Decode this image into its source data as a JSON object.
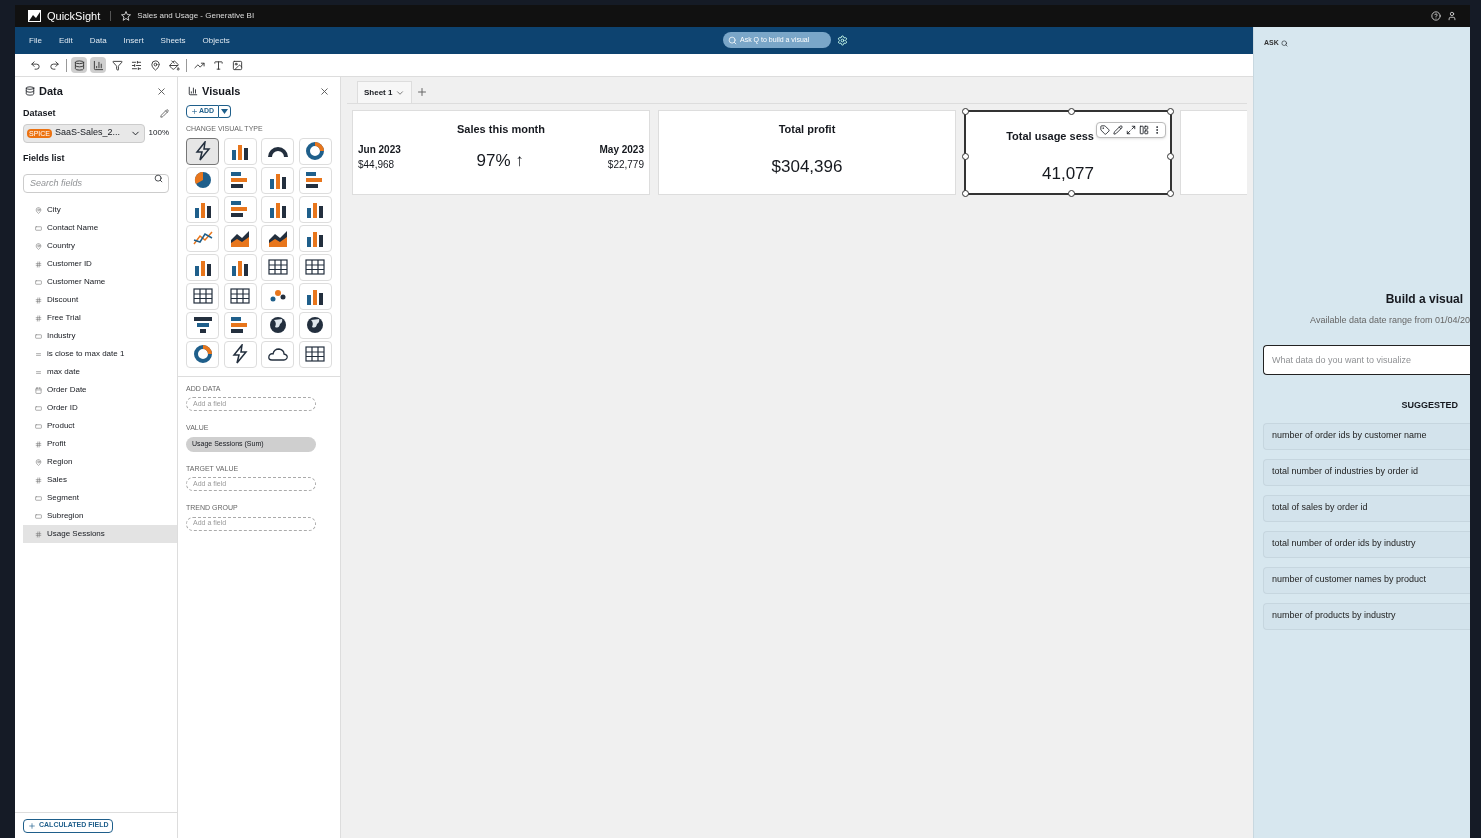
{
  "window": {
    "app": "QuickSight",
    "title": "Sales and Usage - Generative BI"
  },
  "menu": [
    "File",
    "Edit",
    "Data",
    "Insert",
    "Sheets",
    "Objects"
  ],
  "ask_q": {
    "placeholder": "Ask Q to build a visual"
  },
  "toolbar": [
    {
      "selected": false
    },
    {
      "selected": false
    },
    {
      "selected": true
    },
    {
      "selected": true
    },
    {
      "selected": false
    },
    {
      "selected": false
    },
    {
      "selected": false
    },
    {
      "selected": false
    },
    {
      "selected": false
    },
    {
      "selected": false
    },
    {
      "selected": false
    }
  ],
  "data_panel": {
    "title": "Data",
    "dataset_label": "Dataset",
    "dataset": {
      "badge": "SPICE",
      "name": "SaaS-Sales_2...",
      "percent": "100%"
    },
    "fields_label": "Fields list",
    "search": {
      "placeholder": "Search fields"
    },
    "fields": [
      {
        "name": "City",
        "kind": "geo",
        "selected": false
      },
      {
        "name": "Contact Name",
        "kind": "text",
        "selected": false
      },
      {
        "name": "Country",
        "kind": "geo",
        "selected": false
      },
      {
        "name": "Customer ID",
        "kind": "number",
        "selected": false
      },
      {
        "name": "Customer Name",
        "kind": "text",
        "selected": false
      },
      {
        "name": "Discount",
        "kind": "number",
        "selected": false
      },
      {
        "name": "Free Trial",
        "kind": "number",
        "selected": false
      },
      {
        "name": "Industry",
        "kind": "text",
        "selected": false
      },
      {
        "name": "is close to max date 1",
        "kind": "calc",
        "selected": false
      },
      {
        "name": "max date",
        "kind": "calc",
        "selected": false
      },
      {
        "name": "Order Date",
        "kind": "date",
        "selected": false
      },
      {
        "name": "Order ID",
        "kind": "text",
        "selected": false
      },
      {
        "name": "Product",
        "kind": "text",
        "selected": false
      },
      {
        "name": "Profit",
        "kind": "number",
        "selected": false
      },
      {
        "name": "Region",
        "kind": "geo",
        "selected": false
      },
      {
        "name": "Sales",
        "kind": "number",
        "selected": false
      },
      {
        "name": "Segment",
        "kind": "text",
        "selected": false
      },
      {
        "name": "Subregion",
        "kind": "text",
        "selected": false
      },
      {
        "name": "Usage Sessions",
        "kind": "number",
        "selected": true
      }
    ],
    "calculated_field": "CALCULATED FIELD"
  },
  "visuals_panel": {
    "title": "Visuals",
    "add": "ADD",
    "change_label": "CHANGE VISUAL TYPE",
    "visual_types": [
      {
        "selected": true
      },
      {
        "selected": false
      },
      {
        "selected": false
      },
      {
        "selected": false
      },
      {
        "selected": false
      },
      {
        "selected": false
      },
      {
        "selected": false
      },
      {
        "selected": false
      },
      {
        "selected": false
      },
      {
        "selected": false
      },
      {
        "selected": false
      },
      {
        "selected": false
      },
      {
        "selected": false
      },
      {
        "selected": false
      },
      {
        "selected": false
      },
      {
        "selected": false
      },
      {
        "selected": false
      },
      {
        "selected": false
      },
      {
        "selected": false
      },
      {
        "selected": false
      },
      {
        "selected": false
      },
      {
        "selected": false
      },
      {
        "selected": false
      },
      {
        "selected": false
      },
      {
        "selected": false
      },
      {
        "selected": false
      },
      {
        "selected": false
      },
      {
        "selected": false
      },
      {
        "selected": false
      },
      {
        "selected": false
      },
      {
        "selected": false
      },
      {
        "selected": false
      }
    ],
    "wells": [
      {
        "label": "ADD DATA",
        "placeholder": "Add a field"
      },
      {
        "label": "VALUE",
        "value": "Usage Sessions (Sum)"
      },
      {
        "label": "TARGET VALUE",
        "placeholder": "Add a field"
      },
      {
        "label": "TREND GROUP",
        "placeholder": "Add a field"
      }
    ]
  },
  "sheets": [
    {
      "label": "Sheet 1",
      "selected": true
    }
  ],
  "cards": [
    {
      "kind": "comparison",
      "title": "Sales this month",
      "current_period": "Jun 2023",
      "current_value": "$44,968",
      "change": "97%",
      "arrow": "↑",
      "previous_period": "May 2023",
      "previous_value": "$22,779",
      "selected": false
    },
    {
      "kind": "value",
      "title": "Total profit",
      "value": "$304,396",
      "selected": false
    },
    {
      "kind": "value",
      "title": "Total usage sess",
      "value": "41,077",
      "selected": true
    },
    {
      "kind": "empty",
      "selected": false
    }
  ],
  "ask_panel": {
    "title": "ASK",
    "heading": "Build a visual",
    "subtitle": "Available data date range from 01/04/20",
    "input": {
      "placeholder": "What data do you want to visualize"
    },
    "suggested_label": "SUGGESTED",
    "suggestions": [
      "number of order ids by customer name",
      "total number of industries by order id",
      "total of sales by order id",
      "total number of order ids by industry",
      "number of customer names by product",
      "number of products by industry"
    ]
  }
}
